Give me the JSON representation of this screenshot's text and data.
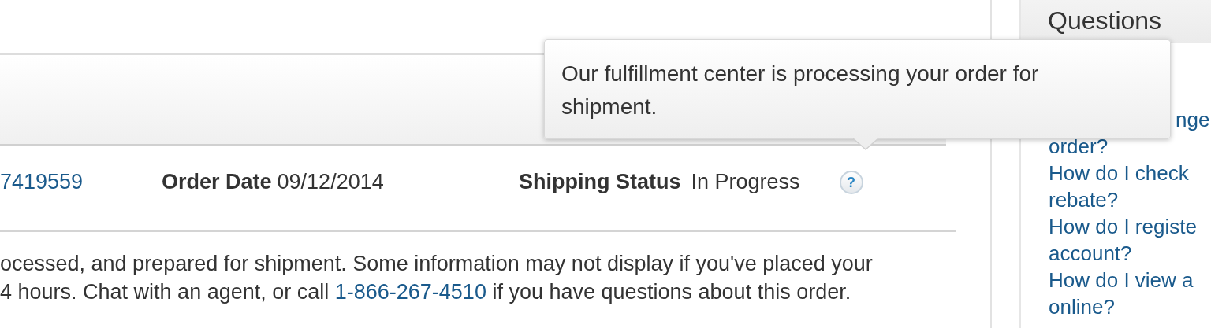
{
  "order": {
    "number": "7419559",
    "date_label": "Order Date",
    "date": "09/12/2014",
    "status_label": "Shipping Status",
    "status": "In Progress",
    "help_icon": "?"
  },
  "tooltip": {
    "text": "Our fulfillment center is processing your order for shipment."
  },
  "notice": {
    "line_1": "ocessed, and prepared for shipment. Some information may not display if you've placed your",
    "line_2_before": "4 hours. Chat with an agent, or call",
    "phone": "1-866-267-4510",
    "line_2_after": "if you have questions about this order."
  },
  "sidebar": {
    "title": "Questions",
    "links": [
      {
        "kind": "covered",
        "lines": [
          "nge",
          "order?"
        ]
      },
      {
        "lines": [
          "How do I check",
          "rebate?"
        ]
      },
      {
        "lines": [
          "How do I registe",
          "account?"
        ]
      },
      {
        "lines": [
          "How do I view a",
          "online?"
        ]
      }
    ]
  }
}
